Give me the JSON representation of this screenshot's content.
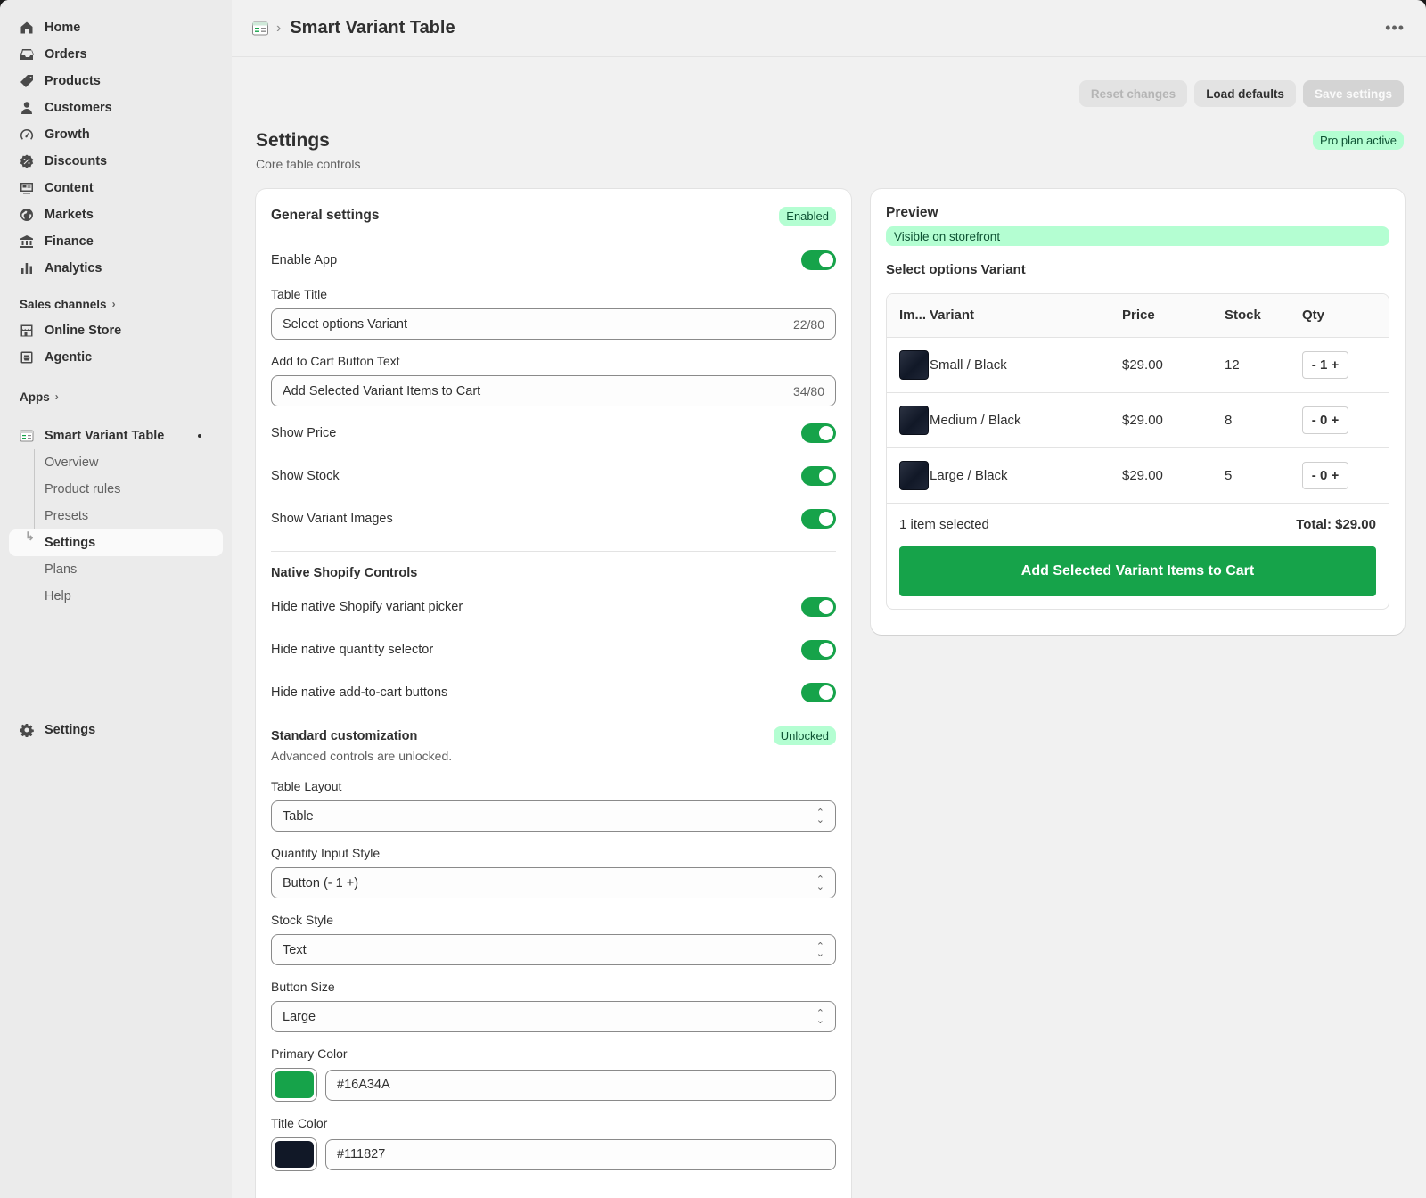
{
  "sidebar": {
    "nav": [
      {
        "label": "Home",
        "icon": "home-icon"
      },
      {
        "label": "Orders",
        "icon": "inbox-icon"
      },
      {
        "label": "Products",
        "icon": "tag-icon"
      },
      {
        "label": "Customers",
        "icon": "person-icon"
      },
      {
        "label": "Growth",
        "icon": "gauge-icon"
      },
      {
        "label": "Discounts",
        "icon": "discount-icon"
      },
      {
        "label": "Content",
        "icon": "content-icon"
      },
      {
        "label": "Markets",
        "icon": "globe-icon"
      },
      {
        "label": "Finance",
        "icon": "bank-icon"
      },
      {
        "label": "Analytics",
        "icon": "bar-chart-icon"
      }
    ],
    "sales_channels_label": "Sales channels",
    "channels": [
      {
        "label": "Online Store",
        "icon": "store-icon"
      },
      {
        "label": "Agentic",
        "icon": "agentic-icon"
      }
    ],
    "apps_label": "Apps",
    "app_name": "Smart Variant Table",
    "app_subitems": [
      "Overview",
      "Product rules",
      "Presets",
      "Settings",
      "Plans",
      "Help"
    ],
    "active_subitem": "Settings",
    "settings_label": "Settings"
  },
  "topbar": {
    "title": "Smart Variant Table",
    "more": "•••"
  },
  "actions": {
    "reset": "Reset changes",
    "load_defaults": "Load defaults",
    "save": "Save settings"
  },
  "page": {
    "title": "Settings",
    "subtitle": "Core table controls",
    "plan_badge": "Pro plan active"
  },
  "general": {
    "title": "General settings",
    "status": "Enabled",
    "enable_app": "Enable App",
    "table_title_label": "Table Title",
    "table_title_value": "Select options Variant",
    "table_title_count": "22/80",
    "cart_text_label": "Add to Cart Button Text",
    "cart_text_value": "Add Selected Variant Items to Cart",
    "cart_text_count": "34/80",
    "show_price": "Show Price",
    "show_stock": "Show Stock",
    "show_images": "Show Variant Images"
  },
  "native": {
    "title": "Native Shopify Controls",
    "hide_picker": "Hide native Shopify variant picker",
    "hide_qty": "Hide native quantity selector",
    "hide_cart": "Hide native add-to-cart buttons"
  },
  "custom": {
    "title": "Standard customization",
    "status": "Unlocked",
    "helper": "Advanced controls are unlocked.",
    "layout_label": "Table Layout",
    "layout_value": "Table",
    "qty_label": "Quantity Input Style",
    "qty_value": "Button (- 1 +)",
    "stock_label": "Stock Style",
    "stock_value": "Text",
    "size_label": "Button Size",
    "size_value": "Large",
    "primary_label": "Primary Color",
    "primary_value": "#16A34A",
    "title_color_label": "Title Color",
    "title_color_value": "#111827"
  },
  "preview": {
    "title": "Preview",
    "visible": "Visible on storefront",
    "heading": "Select options Variant",
    "columns": [
      "Im...",
      "Variant",
      "Price",
      "Stock",
      "Qty"
    ],
    "rows": [
      {
        "variant": "Small / Black",
        "price": "$29.00",
        "stock": "12",
        "qty": "- 1 +"
      },
      {
        "variant": "Medium / Black",
        "price": "$29.00",
        "stock": "8",
        "qty": "- 0 +"
      },
      {
        "variant": "Large / Black",
        "price": "$29.00",
        "stock": "5",
        "qty": "- 0 +"
      }
    ],
    "selected": "1 item selected",
    "total": "Total: $29.00",
    "cart_button": "Add Selected Variant Items to Cart"
  },
  "colors": {
    "primary": "#16A34A",
    "title": "#111827",
    "success_badge": "#B4FED2"
  }
}
